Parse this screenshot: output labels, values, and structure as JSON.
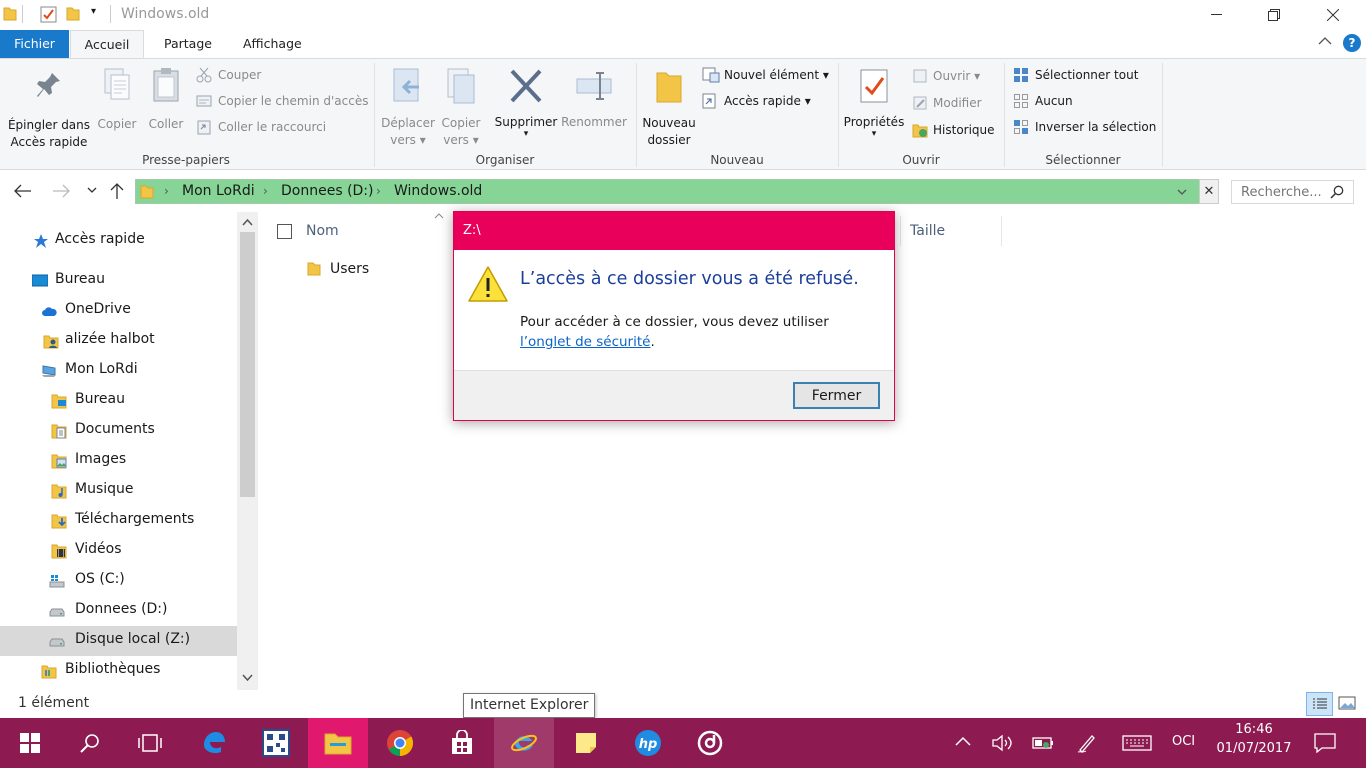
{
  "window": {
    "title": "Windows.old"
  },
  "tabs": {
    "fichier": "Fichier",
    "accueil": "Accueil",
    "partage": "Partage",
    "affichage": "Affichage"
  },
  "ribbon": {
    "clipboard": {
      "pin_line1": "Épingler dans",
      "pin_line2": "Accès rapide",
      "copy": "Copier",
      "paste": "Coller",
      "cut": "Couper",
      "copy_path": "Copier le chemin d'accès",
      "paste_shortcut": "Coller le raccourci",
      "group": "Presse-papiers"
    },
    "organize": {
      "move_line1": "Déplacer",
      "move_line2": "vers",
      "copyto_line1": "Copier",
      "copyto_line2": "vers",
      "delete": "Supprimer",
      "rename": "Renommer",
      "group": "Organiser"
    },
    "new": {
      "folder_line1": "Nouveau",
      "folder_line2": "dossier",
      "new_item": "Nouvel élément",
      "easy_access": "Accès rapide",
      "group": "Nouveau"
    },
    "open": {
      "properties": "Propriétés",
      "open": "Ouvrir",
      "edit": "Modifier",
      "history": "Historique",
      "group": "Ouvrir"
    },
    "select": {
      "select_all": "Sélectionner tout",
      "select_none": "Aucun",
      "invert": "Inverser la sélection",
      "group": "Sélectionner"
    }
  },
  "address": {
    "crumbs": [
      "Mon LoRdi",
      "Donnees (D:)",
      "Windows.old"
    ],
    "search_placeholder": "Recherche..."
  },
  "nav": {
    "items": [
      {
        "label": "Accès rapide",
        "icon": "star-icon"
      },
      {
        "label": "Bureau",
        "icon": "desktop-icon"
      },
      {
        "label": "OneDrive",
        "icon": "cloud-icon"
      },
      {
        "label": "alizée halbot",
        "icon": "user-folder-icon"
      },
      {
        "label": "Mon LoRdi",
        "icon": "computer-icon"
      },
      {
        "label": "Bureau",
        "icon": "desktop-folder-icon"
      },
      {
        "label": "Documents",
        "icon": "documents-folder-icon"
      },
      {
        "label": "Images",
        "icon": "images-folder-icon"
      },
      {
        "label": "Musique",
        "icon": "music-folder-icon"
      },
      {
        "label": "Téléchargements",
        "icon": "downloads-folder-icon"
      },
      {
        "label": "Vidéos",
        "icon": "videos-folder-icon"
      },
      {
        "label": "OS (C:)",
        "icon": "windows-drive-icon"
      },
      {
        "label": "Donnees (D:)",
        "icon": "drive-icon"
      },
      {
        "label": "Disque local (Z:)",
        "icon": "drive-icon"
      },
      {
        "label": "Bibliothèques",
        "icon": "libraries-icon"
      }
    ]
  },
  "content": {
    "col_name": "Nom",
    "col_size": "Taille",
    "files": [
      {
        "name": "Users",
        "icon": "folder-icon"
      }
    ]
  },
  "dialog": {
    "title": "Z:\\",
    "heading": "L’accès à ce dossier vous a été refusé.",
    "message_prefix": "Pour accéder à ce dossier, vous devez utiliser ",
    "link": "l’onglet de sécurité",
    "message_suffix": ".",
    "button": "Fermer"
  },
  "status": {
    "count": "1 élément"
  },
  "tooltip": "Internet Explorer",
  "tray": {
    "lang": "OCI",
    "time": "16:46",
    "date": "01/07/2017"
  },
  "colors": {
    "taskbar": "#8d1b51",
    "taskbar_active": "#e0196e",
    "dialog_accent": "#e8005a",
    "address_bar": "#86d596",
    "file_tab": "#1979ca"
  }
}
